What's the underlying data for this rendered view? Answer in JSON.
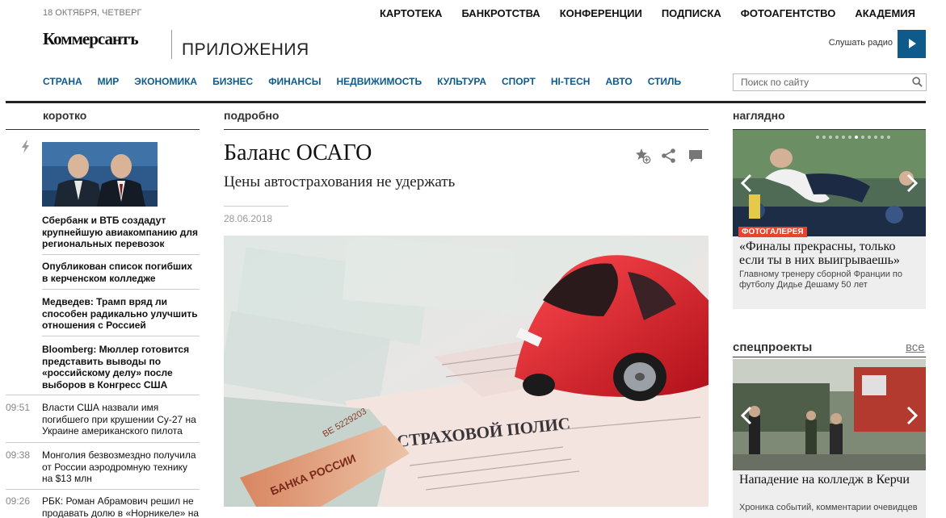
{
  "header": {
    "date": "18 октября, четверг",
    "top_nav": [
      "КАРТОТЕКА",
      "БАНКРОТСТВА",
      "КОНФЕРЕНЦИИ",
      "ПОДПИСКА",
      "ФОТОАГЕНТСТВО",
      "АКАДЕМИЯ"
    ],
    "logo": "Коммерсантъ",
    "logo_sub": "ПРИЛОЖЕНИЯ",
    "radio_label": "Слушать радио",
    "main_nav": [
      "СТРАНА",
      "МИР",
      "ЭКОНОМИКА",
      "БИЗНЕС",
      "ФИНАНСЫ",
      "НЕДВИЖИМОСТЬ",
      "КУЛЬТУРА",
      "СПОРТ",
      "HI-TECH",
      "АВТО",
      "СТИЛЬ"
    ],
    "search_placeholder": "Поиск по сайту",
    "accent_color": "#0e5a8a"
  },
  "left": {
    "heading": "коротко",
    "news": [
      {
        "time": "",
        "text": "Сбербанк и ВТБ создадут крупнейшую авиакомпанию для региональных перевозок",
        "bold": true
      },
      {
        "time": "",
        "text": "Опубликован список погибших в керченском колледже",
        "bold": true
      },
      {
        "time": "",
        "text": "Медведев: Трамп вряд ли способен радикально улучшить отношения с Россией",
        "bold": true
      },
      {
        "time": "",
        "text": "Bloomberg: Мюллер готовится представить выводы по «российскому делу» после выборов в Конгресс США",
        "bold": true
      },
      {
        "time": "09:51",
        "text": "Власти США назвали имя погибшего при крушении Су-27 на Украине американского пилота",
        "bold": false
      },
      {
        "time": "09:38",
        "text": "Монголия безвозмездно получила от России аэродромную технику на $13 млн",
        "bold": false
      },
      {
        "time": "09:26",
        "text": "РБК: Роман Абрамович решил не продавать долю в «Норникеле» на",
        "bold": false
      }
    ]
  },
  "center": {
    "heading": "подробно",
    "title": "Баланс ОСАГО",
    "subtitle": "Цены автострахования не удержать",
    "date": "28.06.2018"
  },
  "right": {
    "heading": "наглядно",
    "gallery": {
      "label": "ФОТОГАЛЕРЕЯ",
      "title": "«Финалы прекрасны, только если ты в них выигрываешь»",
      "desc": "Главному тренеру сборной Франции по футболу Дидье Дешаму 50 лет"
    },
    "spec_heading": "спецпроекты",
    "spec_all": "все",
    "spec": {
      "title": "Нападение на колледж в Керчи",
      "desc": "Хроника событий, комментарии очевидцев"
    }
  }
}
